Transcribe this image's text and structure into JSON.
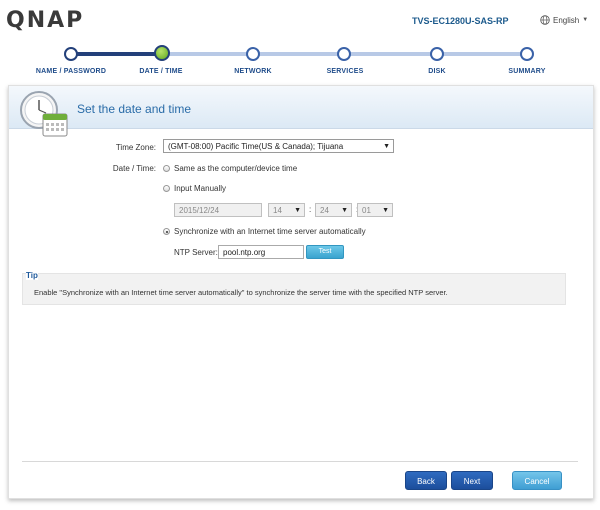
{
  "brand": {
    "logo": "QNAP",
    "device": "TVS-EC1280U-SAS-RP",
    "language": "English",
    "language_icon": "globe-icon"
  },
  "steps": [
    {
      "label": "NAME / PASSWORD",
      "state": "done"
    },
    {
      "label": "DATE / TIME",
      "state": "current"
    },
    {
      "label": "NETWORK",
      "state": "pending"
    },
    {
      "label": "SERVICES",
      "state": "pending"
    },
    {
      "label": "DISK",
      "state": "pending"
    },
    {
      "label": "SUMMARY",
      "state": "pending"
    }
  ],
  "panel": {
    "title": "Set the date and time",
    "icon": "clock-calendar-icon"
  },
  "form": {
    "timezone_label": "Time Zone:",
    "timezone_value": "(GMT-08:00) Pacific Time(US & Canada); Tijuana",
    "datetime_label": "Date / Time:",
    "options": {
      "same_as_device": "Same as the computer/device time",
      "manual": "Input Manually",
      "ntp": "Synchronize with an Internet time server automatically"
    },
    "selected_option": "ntp",
    "manual_date": "2015/12/24",
    "manual_hour": "14",
    "manual_minute": "24",
    "manual_second": "01",
    "time_separator": ":",
    "ntp_label": "NTP Server:",
    "ntp_value": "pool.ntp.org",
    "test_label": "Test"
  },
  "tip": {
    "title": "Tip",
    "text": "Enable \"Synchronize with an Internet time server automatically\" to synchronize the server time with the specified NTP server."
  },
  "buttons": {
    "back": "Back",
    "next": "Next",
    "cancel": "Cancel"
  },
  "colors": {
    "accent": "#23407a",
    "title_blue": "#2a6ca8",
    "button_blue": "#1c4e9c",
    "cancel_blue": "#3f9ed3"
  }
}
